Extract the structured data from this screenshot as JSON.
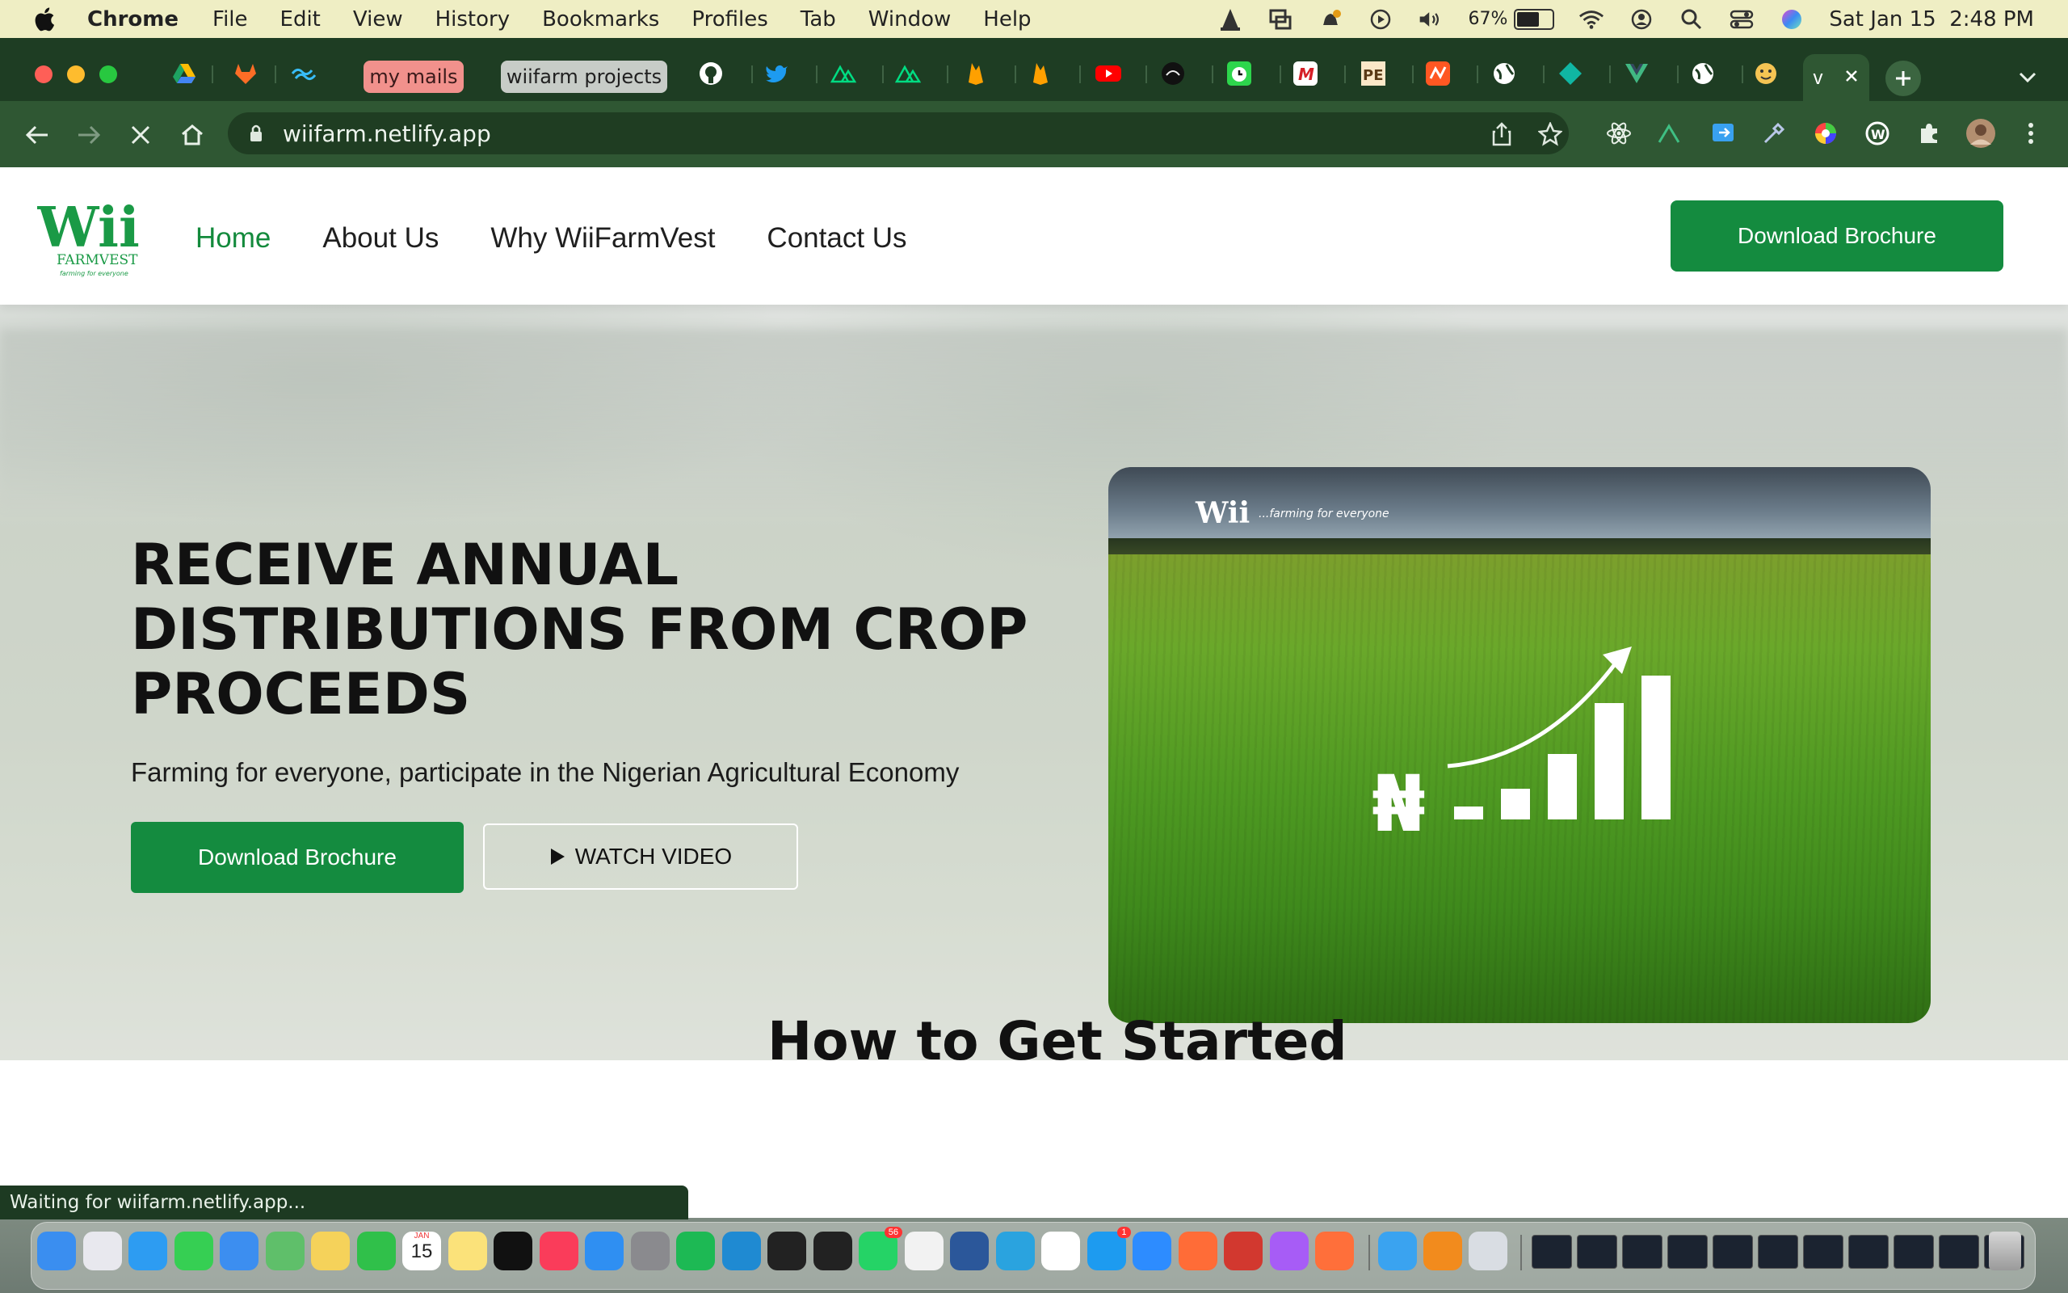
{
  "menubar": {
    "app_name": "Chrome",
    "menus": [
      "File",
      "Edit",
      "View",
      "History",
      "Bookmarks",
      "Profiles",
      "Tab",
      "Window",
      "Help"
    ],
    "battery_percent": "67%",
    "battery_level": 0.67,
    "datetime": "Sat Jan 15  2:48 PM"
  },
  "tabs": {
    "pill_tabs": [
      {
        "label": "my mails",
        "bg": "#f1918c",
        "fg": "#3a1a1a"
      },
      {
        "label": "wiifarm projects",
        "bg": "#c7ccc7",
        "fg": "#202020"
      }
    ],
    "active_tab_label": "v",
    "icons": [
      "google-drive-icon",
      "gitlab-icon",
      "tailwind-icon",
      "github-icon",
      "twitter-icon",
      "nuxt-icon",
      "nuxt-icon",
      "firebase-icon",
      "firebase-icon",
      "youtube-icon",
      "app-icon",
      "clock-icon",
      "app-icon",
      "app-icon",
      "app-icon",
      "globe-icon",
      "gem-icon",
      "vue-icon",
      "globe-icon",
      "emoji-icon"
    ]
  },
  "toolbar": {
    "url": "wiifarm.netlify.app"
  },
  "site": {
    "logo_text": "Wii",
    "logo_sub": "FARMVEST",
    "logo_tagline": "farming for everyone",
    "nav": [
      {
        "label": "Home",
        "active": true
      },
      {
        "label": "About Us",
        "active": false
      },
      {
        "label": "Why WiiFarmVest",
        "active": false
      },
      {
        "label": "Contact Us",
        "active": false
      }
    ],
    "header_button": "Download Brochure",
    "accent": "#148b3f"
  },
  "hero": {
    "title": "RECEIVE ANNUAL DISTRIBUTIONS FROM CROP PROCEEDS",
    "subtitle": "Farming for everyone, participate in the Nigerian Agricultural Economy",
    "primary_button": "Download Brochure",
    "secondary_button": "WATCH VIDEO",
    "card_logo": "Wii",
    "card_tagline": "...farming for everyone",
    "card_currency": "₦"
  },
  "section2": {
    "title": "How to Get Started"
  },
  "status": {
    "text": "Waiting for wiifarm.netlify.app..."
  },
  "dock": {
    "calendar_day": "15",
    "calendar_month": "JAN",
    "whatsapp_badge": "56",
    "twitter_badge": "1"
  }
}
